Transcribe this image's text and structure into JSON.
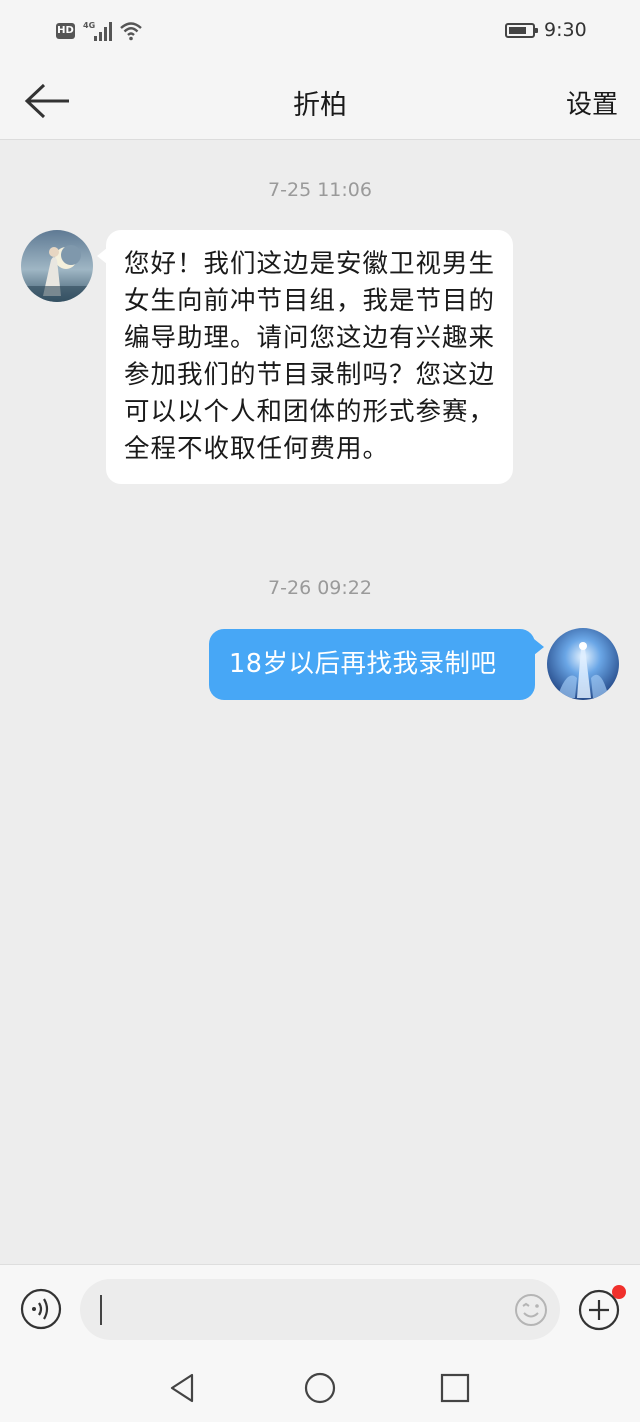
{
  "status_bar": {
    "hd_badge": "HD",
    "network": "4G",
    "time": "9:30",
    "icons": [
      "hd-icon",
      "signal-icon",
      "wifi-icon",
      "battery-icon"
    ]
  },
  "header": {
    "title": "折柏",
    "settings_label": "设置",
    "back_icon": "arrow-left-icon"
  },
  "messages": [
    {
      "timestamp": "7-25 11:06",
      "direction": "incoming",
      "text": "您好！我们这边是安徽卫视男生女生向前冲节目组，我是节目的编导助理。请问您这边有兴趣来参加我们的节目录制吗？您这边可以以个人和团体的形式参赛，全程不收取任何费用。"
    },
    {
      "timestamp": "7-26 09:22",
      "direction": "outgoing",
      "text": "18岁以后再找我录制吧"
    }
  ],
  "input_bar": {
    "text_value": "",
    "voice_icon": "voice-icon",
    "emoji_icon": "emoji-icon",
    "plus_icon": "plus-icon",
    "has_notification_dot": true
  },
  "nav_bar": {
    "icons": [
      "back-triangle-icon",
      "home-circle-icon",
      "recents-square-icon"
    ]
  },
  "colors": {
    "background": "#ededed",
    "outgoing_bubble": "#47a7f6",
    "incoming_bubble": "#ffffff",
    "notification_dot": "#f0302c"
  }
}
